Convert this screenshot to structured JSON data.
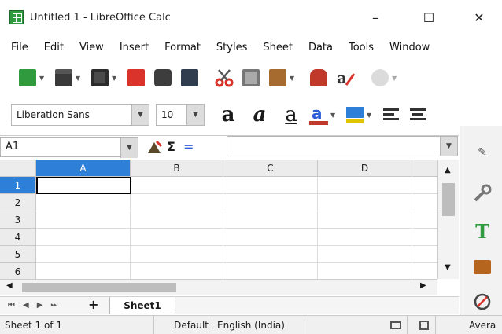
{
  "window": {
    "title": "Untitled 1 - LibreOffice Calc",
    "minimize": "–",
    "maximize": "☐",
    "close": "✕"
  },
  "menu": {
    "items": [
      "File",
      "Edit",
      "View",
      "Insert",
      "Format",
      "Styles",
      "Sheet",
      "Data",
      "Tools",
      "Window"
    ]
  },
  "format_toolbar": {
    "font_name": "Liberation Sans",
    "font_size": "10",
    "bold_glyph": "a",
    "italic_glyph": "a",
    "underline_glyph": "a"
  },
  "formula_bar": {
    "name_box": "A1",
    "sum_glyph": "Σ",
    "equals_glyph": "="
  },
  "grid": {
    "columns": [
      "A",
      "B",
      "C",
      "D"
    ],
    "rows": [
      "1",
      "2",
      "3",
      "4",
      "5",
      "6"
    ],
    "active_cell": "A1"
  },
  "sheets": {
    "add_label": "+",
    "tabs": [
      "Sheet1"
    ]
  },
  "status": {
    "sheet_info": "Sheet 1 of 1",
    "page_style": "Default",
    "language": "English (India)",
    "avg_label": "Avera"
  },
  "colors": {
    "accent": "#2d7fd8",
    "calc_green": "#2f9a3e"
  }
}
